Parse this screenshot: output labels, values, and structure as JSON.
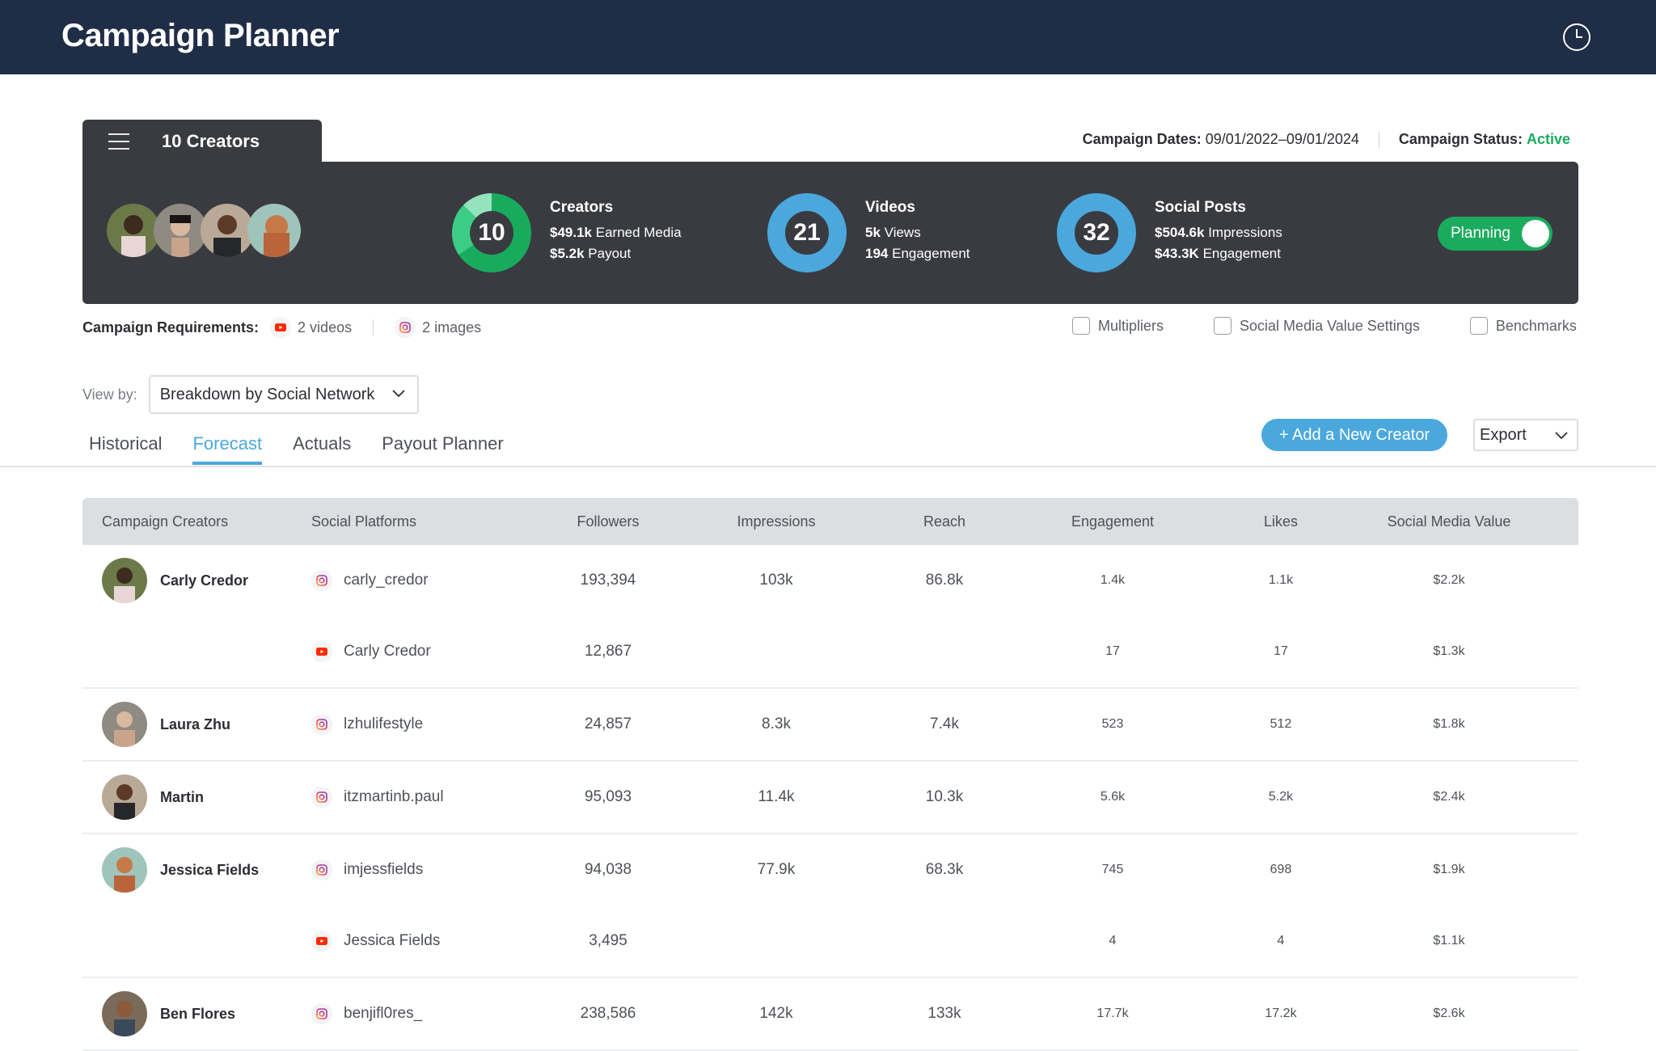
{
  "app": {
    "title": "Campaign Planner"
  },
  "summary_tab": {
    "label": "10 Creators"
  },
  "campaign": {
    "dates_label": "Campaign Dates:",
    "dates_value": "09/01/2022–09/01/2024",
    "status_label": "Campaign Status:",
    "status_value": "Active",
    "status_color": "#1bab5e"
  },
  "stats": {
    "creators": {
      "count": "10",
      "title": "Creators",
      "line1_value": "$49.1k",
      "line1_label": "Earned Media",
      "line2_value": "$5.2k",
      "line2_label": "Payout"
    },
    "videos": {
      "count": "21",
      "title": "Videos",
      "line1_value": "5k",
      "line1_label": "Views",
      "line2_value": "194",
      "line2_label": "Engagement"
    },
    "social_posts": {
      "count": "32",
      "title": "Social Posts",
      "line1_value": "$504.6k",
      "line1_label": "Impressions",
      "line2_value": "$43.3K",
      "line2_label": "Engagement"
    }
  },
  "planning_toggle": {
    "label": "Planning",
    "on": true
  },
  "requirements": {
    "label": "Campaign Requirements:",
    "items": [
      {
        "icon": "youtube-icon",
        "text": "2 videos"
      },
      {
        "icon": "instagram-icon",
        "text": "2 images"
      }
    ]
  },
  "options": [
    {
      "label": "Multipliers",
      "checked": false
    },
    {
      "label": "Social Media Value Settings",
      "checked": false
    },
    {
      "label": "Benchmarks",
      "checked": false
    }
  ],
  "view_by": {
    "label": "View by:",
    "selected": "Breakdown by Social Network"
  },
  "tabs": [
    {
      "label": "Historical",
      "active": false
    },
    {
      "label": "Forecast",
      "active": true
    },
    {
      "label": "Actuals",
      "active": false
    },
    {
      "label": "Payout Planner",
      "active": false
    }
  ],
  "actions": {
    "add_creator": "+ Add a New Creator",
    "export": "Export"
  },
  "table": {
    "headers": [
      "Campaign Creators",
      "Social Platforms",
      "Followers",
      "Impressions",
      "Reach",
      "Engagement",
      "Likes",
      "Social Media Value"
    ],
    "groups": [
      {
        "creator": "Carly Credor",
        "rows": [
          {
            "platform": "instagram",
            "handle": "carly_credor",
            "followers": "193,394",
            "impressions": "103k",
            "reach": "86.8k",
            "engagement": "1.4k",
            "likes": "1.1k",
            "smv": "$2.2k"
          },
          {
            "platform": "youtube",
            "handle": "Carly Credor",
            "followers": "12,867",
            "impressions": "",
            "reach": "",
            "engagement": "17",
            "likes": "17",
            "smv": "$1.3k"
          }
        ]
      },
      {
        "creator": "Laura Zhu",
        "rows": [
          {
            "platform": "instagram",
            "handle": "lzhulifestyle",
            "followers": "24,857",
            "impressions": "8.3k",
            "reach": "7.4k",
            "engagement": "523",
            "likes": "512",
            "smv": "$1.8k"
          }
        ]
      },
      {
        "creator": "Martin",
        "rows": [
          {
            "platform": "instagram",
            "handle": "itzmartinb.paul",
            "followers": "95,093",
            "impressions": "11.4k",
            "reach": "10.3k",
            "engagement": "5.6k",
            "likes": "5.2k",
            "smv": "$2.4k"
          }
        ]
      },
      {
        "creator": "Jessica Fields",
        "rows": [
          {
            "platform": "instagram",
            "handle": "imjessfields",
            "followers": "94,038",
            "impressions": "77.9k",
            "reach": "68.3k",
            "engagement": "745",
            "likes": "698",
            "smv": "$1.9k"
          },
          {
            "platform": "youtube",
            "handle": "Jessica Fields",
            "followers": "3,495",
            "impressions": "",
            "reach": "",
            "engagement": "4",
            "likes": "4",
            "smv": "$1.1k"
          }
        ]
      },
      {
        "creator": "Ben Flores",
        "rows": [
          {
            "platform": "instagram",
            "handle": "benjifl0res_",
            "followers": "238,586",
            "impressions": "142k",
            "reach": "133k",
            "engagement": "17.7k",
            "likes": "17.2k",
            "smv": "$2.6k"
          }
        ]
      }
    ]
  },
  "colors": {
    "header_bg": "#1f2d46",
    "panel_bg": "#3a3b40",
    "accent_blue": "#4aa8dd",
    "accent_green": "#1bab5e",
    "youtube_red": "#ff2a00"
  }
}
